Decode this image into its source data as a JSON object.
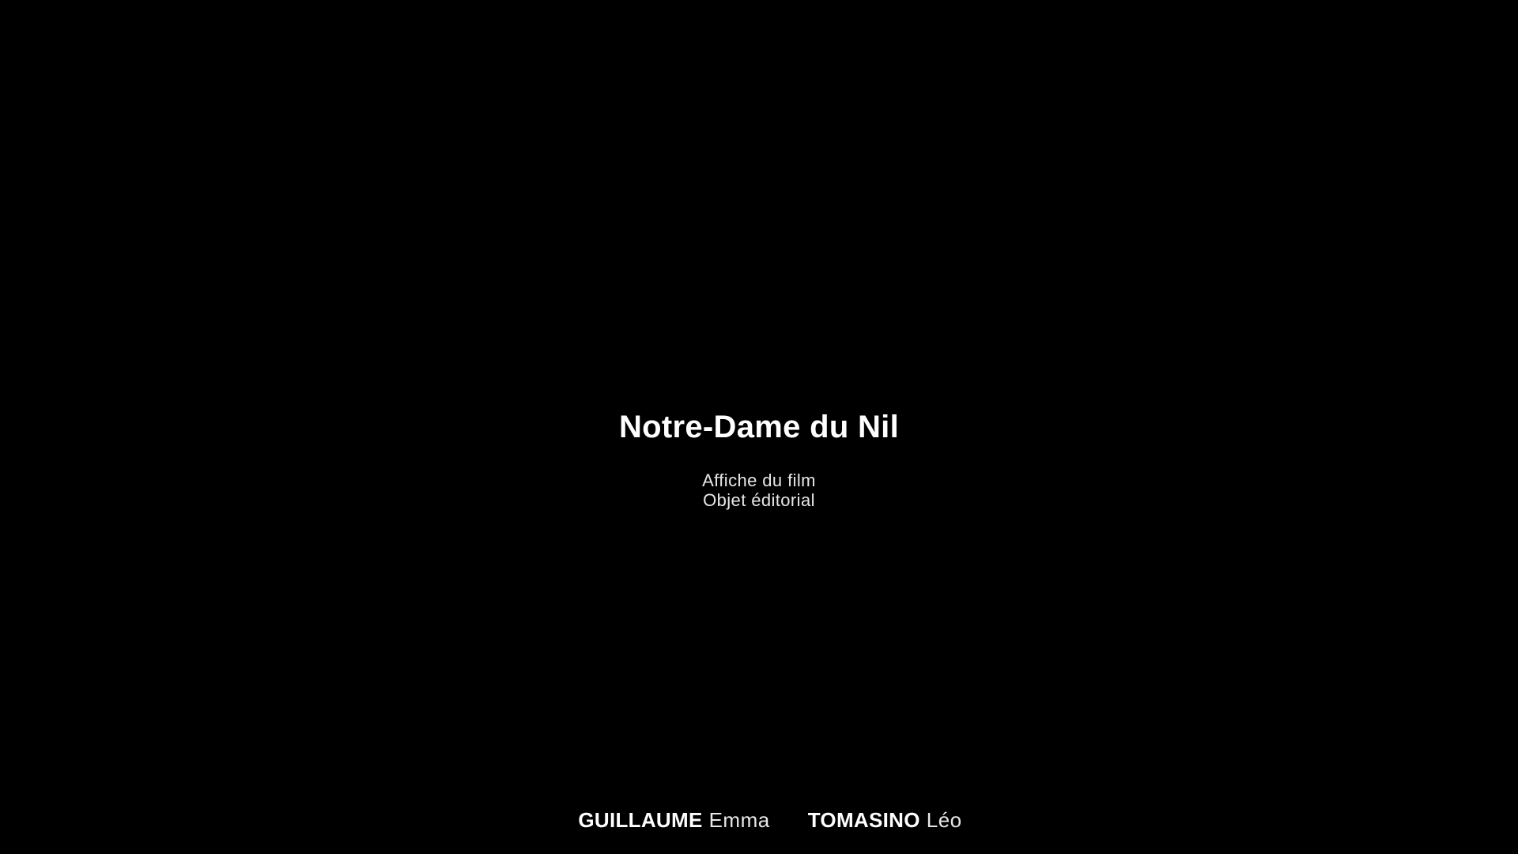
{
  "slide": {
    "title": "Notre-Dame du Nil",
    "subtitle_lines": [
      "Affiche du film",
      "Objet éditorial"
    ],
    "authors": [
      {
        "last_name": "GUILLAUME",
        "first_name": "Emma"
      },
      {
        "last_name": "TOMASINO",
        "first_name": "Léo"
      }
    ],
    "colors": {
      "background": "#000000",
      "text": "#ffffff"
    }
  }
}
